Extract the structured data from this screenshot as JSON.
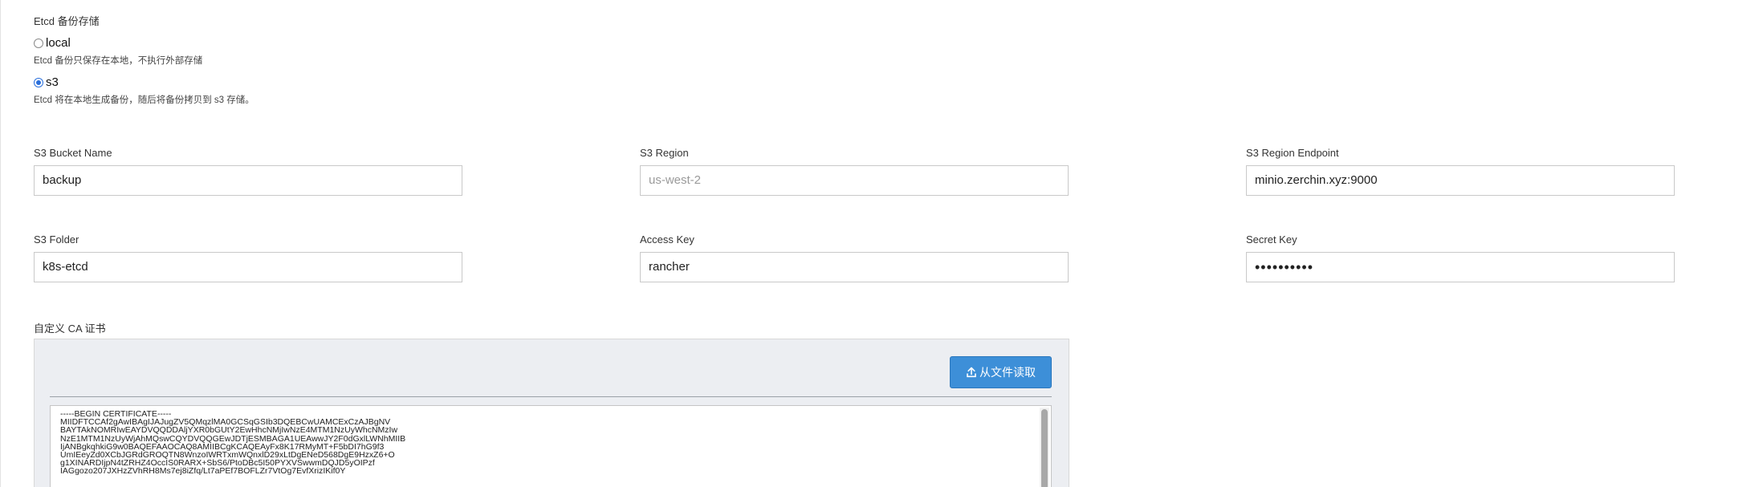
{
  "etcd_backup": {
    "section_title": "Etcd 备份存储",
    "options": [
      {
        "label": "local",
        "help": "Etcd 备份只保存在本地，不执行外部存储",
        "selected": false
      },
      {
        "label": "s3",
        "help": "Etcd 将在本地生成备份，随后将备份拷贝到 s3 存储。",
        "selected": true
      }
    ]
  },
  "s3": {
    "bucket_name": {
      "label": "S3 Bucket Name",
      "value": "backup"
    },
    "region": {
      "label": "S3 Region",
      "value": "",
      "placeholder": "us-west-2"
    },
    "region_endpoint": {
      "label": "S3 Region Endpoint",
      "value": "minio.zerchin.xyz:9000"
    },
    "folder": {
      "label": "S3 Folder",
      "value": "k8s-etcd"
    },
    "access_key": {
      "label": "Access Key",
      "value": "rancher"
    },
    "secret_key": {
      "label": "Secret Key",
      "masked_value": "••••••••••"
    }
  },
  "ca": {
    "label": "自定义 CA 证书",
    "read_from_file_button": "从文件读取",
    "button_icon": "upload-icon",
    "accent_color": "#3d8fd8",
    "certificate_lines": [
      "-----BEGIN CERTIFICATE-----",
      "MIIDFTCCAf2gAwIBAgIJAJugZV5QMqzlMA0GCSqGSIb3DQEBCwUAMCExCzAJBgNV",
      "BAYTAkNOMRIwEAYDVQQDDAljYXR0bGUtY2EwHhcNMjIwNzE4MTM1NzUyWhcNMzIw",
      "NzE1MTM1NzUyWjAhMQswCQYDVQQGEwJDTjESMBAGA1UEAwwJY2F0dGxlLWNhMIIB",
      "IjANBgkqhkiG9w0BAQEFAAOCAQ8AMIIBCgKCAQEAyFx8K17RMyMT+F5bDI7hG9f3",
      "UmIEeyZd0XCbJGRdGROQTN8WnzoIWRTxmWQnxlD29xLtDgENeD568DgE9HzxZ6+O",
      "g1XINARDIjpN4tZRHZ4OccIS0RARX+SbS6/PtoDBc5I50PYXVSwwmDQJD5yOIPzf",
      "IAGgozo207JXHzZVhRH8Ms7ej8iZfq/Lt7aPEf7BOFLZr7VtOg7EvfXrizIKif0Y"
    ]
  }
}
